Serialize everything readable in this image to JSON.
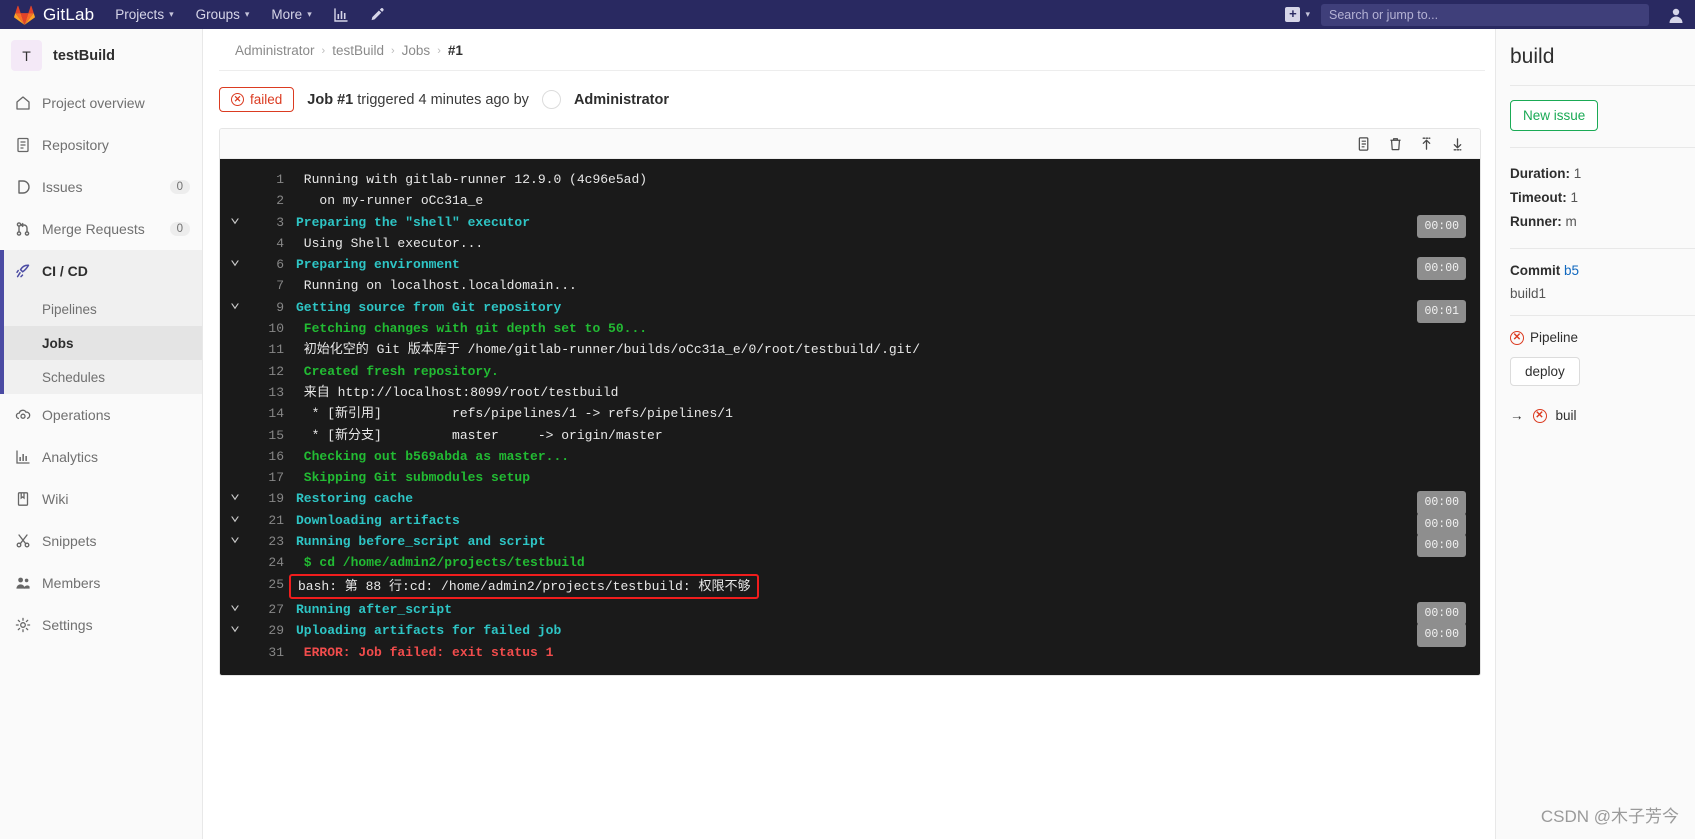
{
  "topbar": {
    "brand": "GitLab",
    "nav": [
      {
        "label": "Projects",
        "caret": "chevron-down-icon"
      },
      {
        "label": "Groups",
        "caret": "chevron-down-icon"
      },
      {
        "label": "More",
        "caret": "chevron-down-icon"
      }
    ],
    "icons": [
      "analytics-icon",
      "snippet-pen-icon"
    ],
    "plus_label": "+",
    "plus_caret": "chevron-down-icon",
    "search_placeholder": "Search or jump to...",
    "search_value": "",
    "bg_color": "#292961"
  },
  "sidebar": {
    "project_initial": "T",
    "project_name": "testBuild",
    "items": [
      {
        "label": "Project overview",
        "icon": "home-icon",
        "badge": null
      },
      {
        "label": "Repository",
        "icon": "file-document-icon",
        "badge": null
      },
      {
        "label": "Issues",
        "icon": "issue-icon",
        "badge": "0"
      },
      {
        "label": "Merge Requests",
        "icon": "merge-request-icon",
        "badge": "0"
      },
      {
        "label": "CI / CD",
        "icon": "rocket-icon",
        "badge": null,
        "active": true
      },
      {
        "label": "Operations",
        "icon": "cloud-gear-icon",
        "badge": null
      },
      {
        "label": "Analytics",
        "icon": "chart-bar-icon",
        "badge": null
      },
      {
        "label": "Wiki",
        "icon": "book-icon",
        "badge": null
      },
      {
        "label": "Snippets",
        "icon": "scissors-icon",
        "badge": null
      },
      {
        "label": "Members",
        "icon": "users-icon",
        "badge": null
      },
      {
        "label": "Settings",
        "icon": "gear-icon",
        "badge": null
      }
    ],
    "subitems": [
      {
        "label": "Pipelines",
        "selected": false
      },
      {
        "label": "Jobs",
        "selected": true
      },
      {
        "label": "Schedules",
        "selected": false
      }
    ]
  },
  "breadcrumb": [
    {
      "label": "Administrator",
      "last": false
    },
    {
      "label": "testBuild",
      "last": false
    },
    {
      "label": "Jobs",
      "last": false
    },
    {
      "label": "#1",
      "last": true
    }
  ],
  "job_header": {
    "status": "failed",
    "status_icon": "x-circle-icon",
    "status_color": "#db3b21",
    "job_label": "Job #1",
    "triggered_text": "triggered 4 minutes ago by",
    "avatar": "user-avatar",
    "user": "Administrator"
  },
  "log_toolbar": {
    "icons": [
      {
        "name": "raw-log-icon"
      },
      {
        "name": "trash-icon"
      },
      {
        "name": "scroll-to-top-icon"
      },
      {
        "name": "scroll-to-bottom-icon"
      }
    ]
  },
  "log": {
    "lines": [
      {
        "num": "1",
        "chev": false,
        "text": " Running with gitlab-runner 12.9.0 (4c96e5ad)",
        "color": "c-white",
        "dur": null
      },
      {
        "num": "2",
        "chev": false,
        "text": "   on my-runner oCc31a_e",
        "color": "c-white",
        "dur": null
      },
      {
        "num": "3",
        "chev": true,
        "text": "Preparing the \"shell\" executor",
        "color": "c-cyan",
        "dur": "00:00"
      },
      {
        "num": "4",
        "chev": false,
        "text": " Using Shell executor...",
        "color": "c-white",
        "dur": null
      },
      {
        "num": "6",
        "chev": true,
        "text": "Preparing environment",
        "color": "c-cyan",
        "dur": "00:00"
      },
      {
        "num": "7",
        "chev": false,
        "text": " Running on localhost.localdomain...",
        "color": "c-white",
        "dur": null
      },
      {
        "num": "9",
        "chev": true,
        "text": "Getting source from Git repository",
        "color": "c-cyan",
        "dur": "00:01"
      },
      {
        "num": "10",
        "chev": false,
        "text": " Fetching changes with git depth set to 50...",
        "color": "c-green",
        "dur": null
      },
      {
        "num": "11",
        "chev": false,
        "text": " 初始化空的 Git 版本库于 /home/gitlab-runner/builds/oCc31a_e/0/root/testbuild/.git/",
        "color": "c-white",
        "dur": null
      },
      {
        "num": "12",
        "chev": false,
        "text": " Created fresh repository.",
        "color": "c-green",
        "dur": null
      },
      {
        "num": "13",
        "chev": false,
        "text": " 来自 http://localhost:8099/root/testbuild",
        "color": "c-white",
        "dur": null
      },
      {
        "num": "14",
        "chev": false,
        "text": "  * [新引用]         refs/pipelines/1 -> refs/pipelines/1",
        "color": "c-white",
        "dur": null
      },
      {
        "num": "15",
        "chev": false,
        "text": "  * [新分支]         master     -> origin/master",
        "color": "c-white",
        "dur": null
      },
      {
        "num": "16",
        "chev": false,
        "text": " Checking out b569abda as master...",
        "color": "c-green",
        "dur": null
      },
      {
        "num": "17",
        "chev": false,
        "text": " Skipping Git submodules setup",
        "color": "c-green",
        "dur": null
      },
      {
        "num": "19",
        "chev": true,
        "text": "Restoring cache",
        "color": "c-cyan",
        "dur": "00:00"
      },
      {
        "num": "21",
        "chev": true,
        "text": "Downloading artifacts",
        "color": "c-cyan",
        "dur": "00:00"
      },
      {
        "num": "23",
        "chev": true,
        "text": "Running before_script and script",
        "color": "c-cyan",
        "dur": "00:00"
      },
      {
        "num": "24",
        "chev": false,
        "text": " $ cd /home/admin2/projects/testbuild",
        "color": "c-green",
        "dur": null
      },
      {
        "num": "25",
        "chev": false,
        "text": "bash: 第 88 行:cd: /home/admin2/projects/testbuild: 权限不够",
        "color": "c-white",
        "dur": null,
        "highlight": true
      },
      {
        "num": "27",
        "chev": true,
        "text": "Running after_script",
        "color": "c-cyan",
        "dur": "00:00"
      },
      {
        "num": "29",
        "chev": true,
        "text": "Uploading artifacts for failed job",
        "color": "c-cyan",
        "dur": "00:00"
      },
      {
        "num": "31",
        "chev": false,
        "text": " ERROR: Job failed: exit status 1",
        "color": "c-red",
        "dur": null
      }
    ],
    "highlight_color": "#f01d1d"
  },
  "right_panel": {
    "title": "build",
    "new_issue_label": "New issue",
    "duration_label": "Duration:",
    "duration_value": "1",
    "timeout_label": "Timeout:",
    "timeout_value": "1",
    "runner_label": "Runner:",
    "runner_value": "m",
    "commit_label": "Commit",
    "commit_sha": "b5",
    "commit_message": "build1",
    "pipeline_label": "Pipeline",
    "pipeline_status_icon": "x-circle-icon",
    "stage_label": "deploy",
    "job_link_label": "buil",
    "job_link_icon": "x-circle-icon",
    "arrow_icon": "arrow-right-icon"
  },
  "watermark": "CSDN @木子芳今"
}
